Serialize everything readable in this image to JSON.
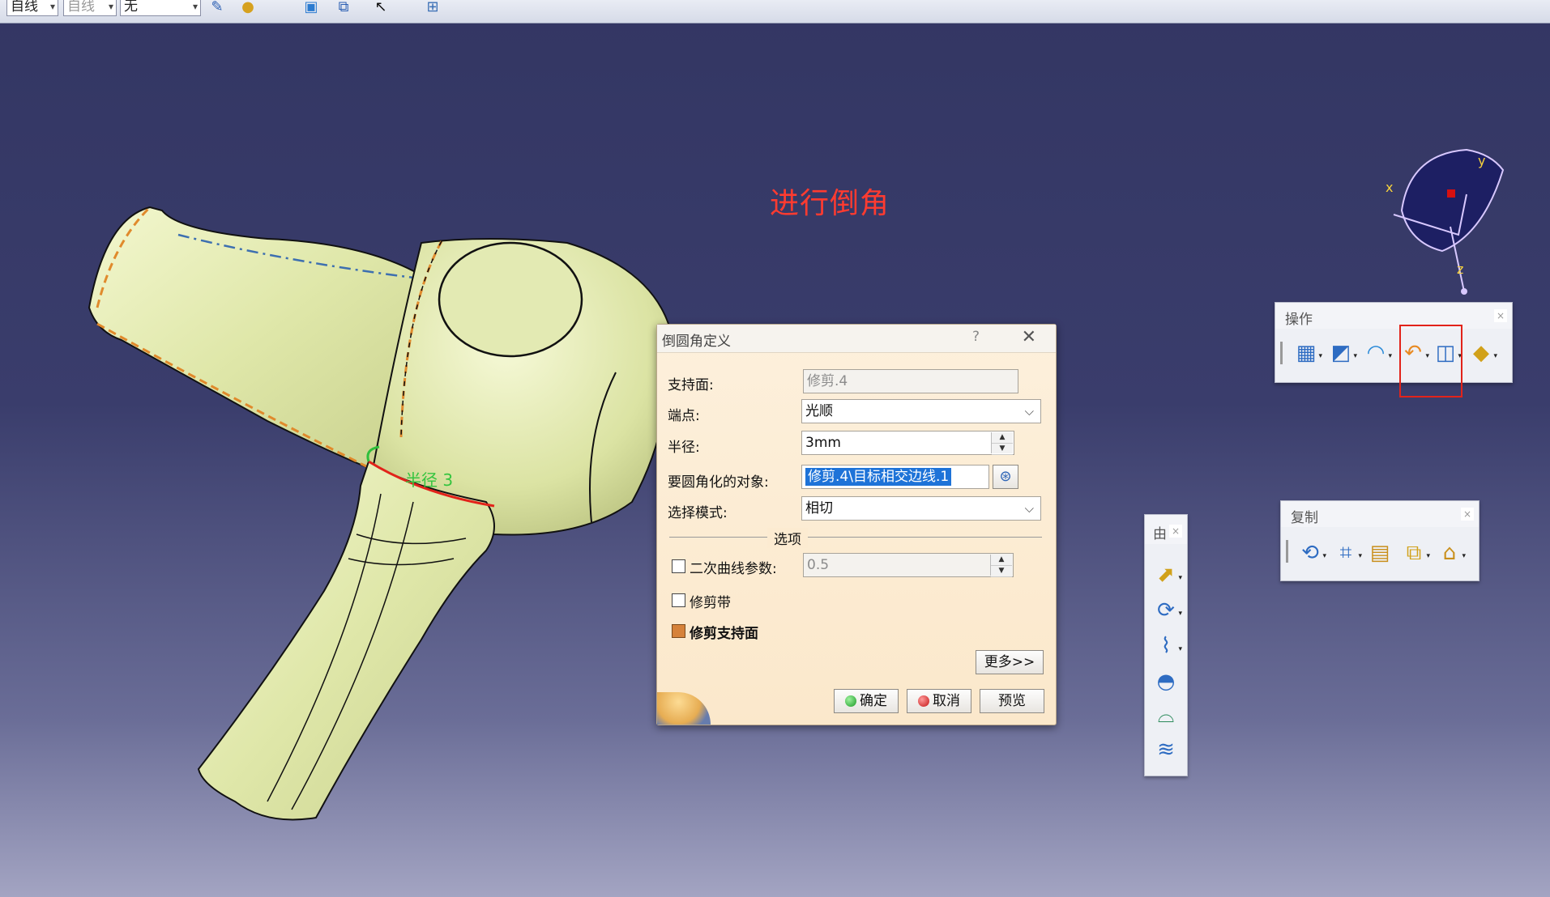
{
  "topbar": {
    "combo1": "自线",
    "combo2": "自线",
    "combo3": "无"
  },
  "caption": "进行倒角",
  "model": {
    "radius_label": "半径 3"
  },
  "compass": {
    "x": "x",
    "y": "y",
    "z": "z"
  },
  "dialog": {
    "title": "倒圆角定义",
    "help": "?",
    "close": "✕",
    "support_label": "支持面:",
    "support_value": "修剪.4",
    "endpoint_label": "端点:",
    "endpoint_value": "光顺",
    "radius_label": "半径:",
    "radius_value": "3mm",
    "objects_label": "要圆角化的对象:",
    "objects_value": "修剪.4\\目标相交边线.1",
    "mode_label": "选择模式:",
    "mode_value": "相切",
    "options_section": "选项",
    "conic_label": "二次曲线参数:",
    "conic_checked": false,
    "conic_value": "0.5",
    "trim_ribbon_label": "修剪带",
    "trim_ribbon_checked": false,
    "trim_support_label": "修剪支持面",
    "trim_support_checked": true,
    "more_button": "更多>>",
    "ok_button": "确定",
    "cancel_button": "取消",
    "preview_button": "预览"
  },
  "toolbar_ops": {
    "title": "操作",
    "close": "×",
    "icons": [
      "join-icon",
      "heal-icon",
      "untrim-icon",
      "fillet-icon",
      "split-icon",
      "transform-icon"
    ]
  },
  "toolbar_copy": {
    "title": "复制",
    "close": "×",
    "icons": [
      "object-repetition-icon",
      "points-repetition-icon",
      "instantiate-icon",
      "duplicate-icon",
      "powercopy-icon"
    ]
  },
  "toolbar_vertical": {
    "title": "由",
    "close": "×",
    "icons": [
      "extrude-icon",
      "revolve-icon",
      "sweep-icon",
      "fill-icon",
      "multisection-icon",
      "offset-icon"
    ]
  },
  "colors": {
    "accent_red": "#e2231a",
    "caption_red": "#ff3b30",
    "model_face": "#dfe7a9",
    "bg_top": "#333663"
  }
}
